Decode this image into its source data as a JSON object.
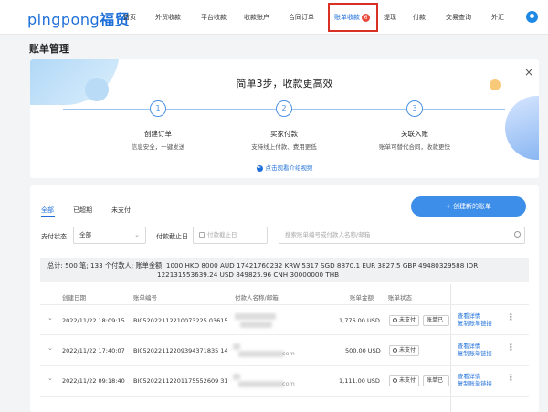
{
  "brand": {
    "latin": "pingpong",
    "cn": "福贸"
  },
  "nav": [
    {
      "label": "首页"
    },
    {
      "label": "外贸收款"
    },
    {
      "label": "平台收款"
    },
    {
      "label": "收款账户"
    },
    {
      "label": "合同订单"
    },
    {
      "label": "账单收款",
      "badge": "6"
    },
    {
      "label": "提现"
    },
    {
      "label": "付款"
    },
    {
      "label": "交易查询"
    },
    {
      "label": "外汇"
    }
  ],
  "page_title": "账单管理",
  "banner": {
    "close": "×",
    "title": "简单3步，收款更高效",
    "steps": [
      {
        "num": "1",
        "title": "创建订单",
        "desc": "信息安全，一键发送"
      },
      {
        "num": "2",
        "title": "买家付款",
        "desc": "支持线上付款、费用更低"
      },
      {
        "num": "3",
        "title": "关联入账",
        "desc": "账单可替代合同，收款更快"
      }
    ],
    "video_link": "点击观看介绍视频"
  },
  "tabs": [
    "全部",
    "已超期",
    "未支付"
  ],
  "create_button": "+ 创建新的账单",
  "filters": {
    "status_label": "支付状态",
    "status_value": "全部",
    "deadline_label": "付款截止日",
    "deadline_placeholder": "付款截止日",
    "search_placeholder": "搜索账单编号或付款人名称/邮箱"
  },
  "summary": {
    "line1": "总计:  500 笔;   133 个付款人;  账单金额:   1000 HKD  8000 AUD  17421760232 KRW  5317 SGD  8870.1 EUR  3827.5 GBP  49480329588 IDR",
    "line2": "122131553639.24 USD  849825.96 CNH  30000000 THB"
  },
  "table": {
    "headers": [
      "创建日期",
      "账单编号",
      "付款人名称/邮箱",
      "账单金额",
      "账单状态"
    ],
    "rows": [
      {
        "date": "2022/11/22 18:09:15",
        "id": "BI052022112210073225 03615",
        "email": "",
        "amount": "1,776.00 USD",
        "status": "未支付",
        "status2": "账单已打",
        "link1": "查看详情",
        "link2": "复制账单链接"
      },
      {
        "date": "2022/11/22 17:40:07",
        "id": "BI052022112209394371835 14",
        "email": "com",
        "amount": "500.00 USD",
        "status": "未支付",
        "status2": "",
        "link1": "查看详情",
        "link2": "复制账单链接"
      },
      {
        "date": "2022/11/22 09:18:40",
        "id": "BI052022112201175552609 31",
        "email": "com",
        "amount": "1,111.00 USD",
        "status": "未支付",
        "status2": "账单已打",
        "link1": "查看详情",
        "link2": "复制账单链接"
      }
    ]
  }
}
